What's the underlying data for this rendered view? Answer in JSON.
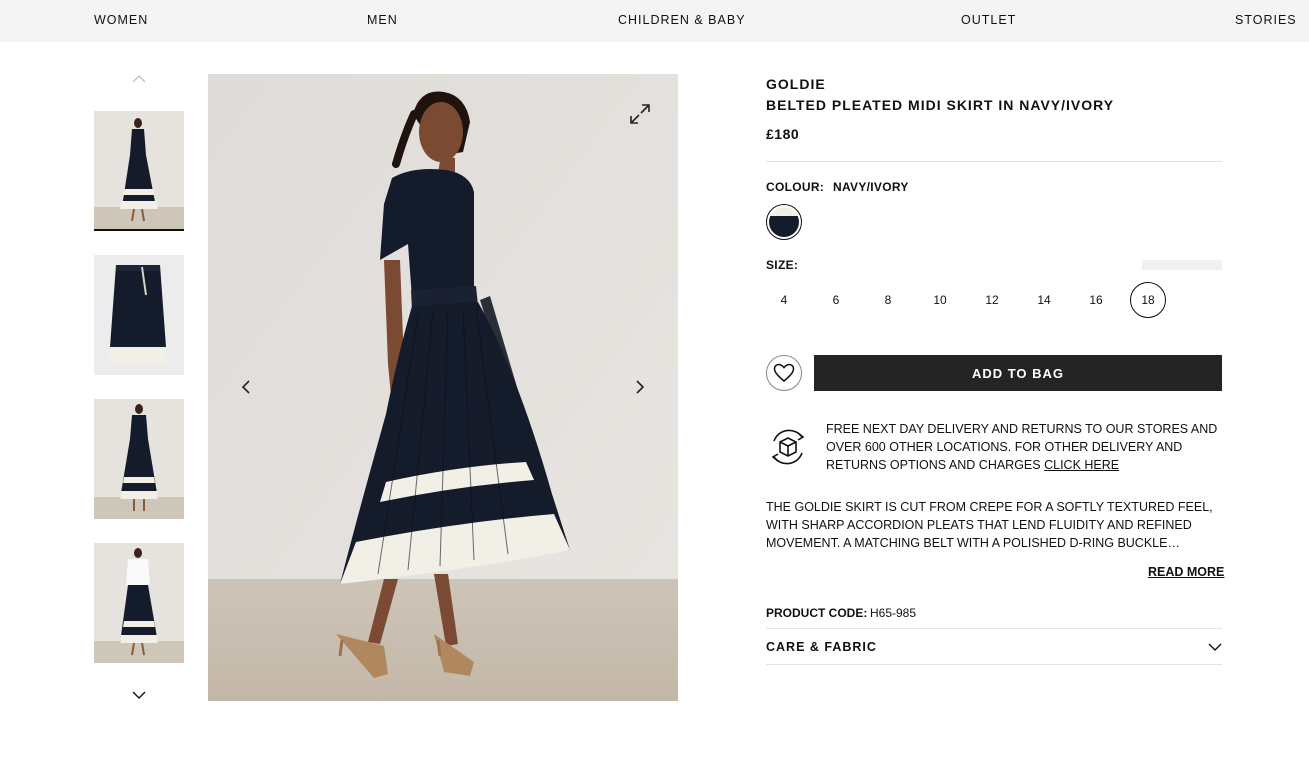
{
  "nav": {
    "items": [
      "WOMEN",
      "MEN",
      "CHILDREN & BABY",
      "OUTLET",
      "STORIES"
    ]
  },
  "product": {
    "brand": "GOLDIE",
    "name": "BELTED PLEATED MIDI SKIRT IN NAVY/IVORY",
    "price": "£180",
    "colour_label": "COLOUR:",
    "colour_value": "NAVY/IVORY",
    "size_label": "SIZE:",
    "sizes": [
      "4",
      "6",
      "8",
      "10",
      "12",
      "14",
      "16",
      "18"
    ],
    "selected_size": "18",
    "add_to_bag": "ADD TO BAG",
    "delivery_text": "FREE NEXT DAY DELIVERY AND RETURNS TO OUR STORES AND OVER 600 OTHER LOCATIONS. FOR OTHER DELIVERY AND RETURNS OPTIONS AND CHARGES",
    "delivery_link": "CLICK HERE",
    "description": "THE GOLDIE SKIRT IS CUT FROM CREPE FOR A SOFTLY TEXTURED FEEL, WITH SHARP ACCORDION PLEATS THAT LEND FLUIDITY AND REFINED MOVEMENT. A MATCHING BELT WITH A POLISHED D-RING BUCKLE CINCHES...",
    "read_more": "READ MORE",
    "code_label": "PRODUCT CODE:",
    "code_value": "H65-985",
    "care_label": "CARE & FABRIC"
  },
  "colors": {
    "navy": "#141b2b",
    "ivory": "#f2efe7",
    "button_dark": "#242424",
    "nav_bg": "#f4f4f4"
  },
  "icons": [
    "chevron-up-icon",
    "chevron-down-icon",
    "expand-icon",
    "chevron-left-icon",
    "chevron-right-icon",
    "heart-icon",
    "delivery-returns-icon"
  ]
}
